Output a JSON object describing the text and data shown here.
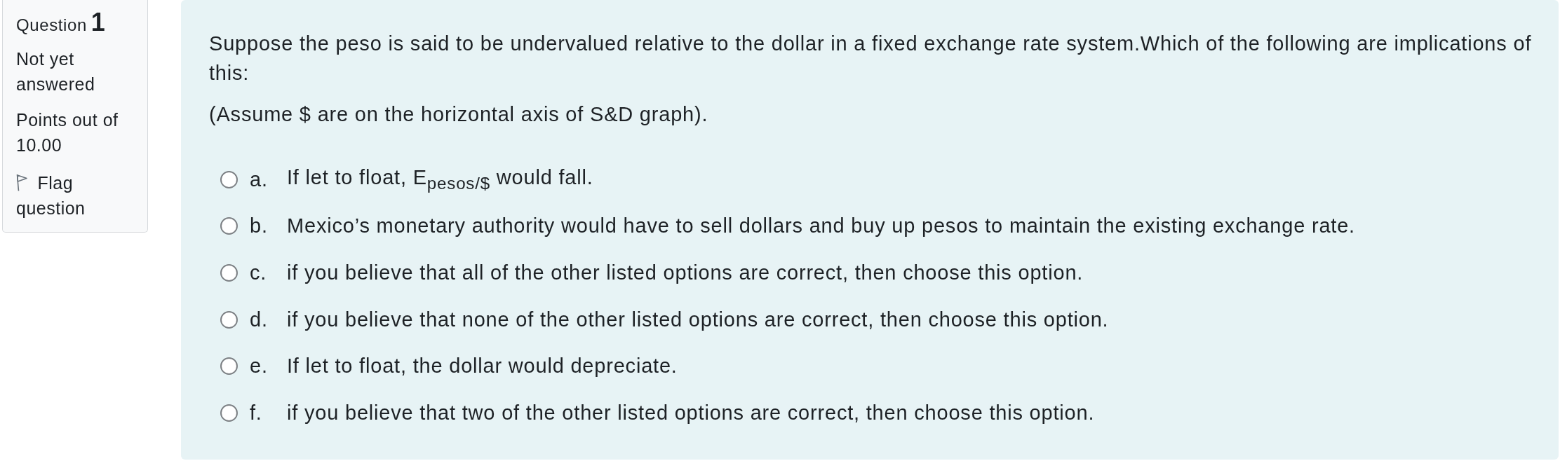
{
  "question_info": {
    "label": "Question",
    "number": "1",
    "status": "Not yet answered",
    "points": "Points out of 10.00",
    "flag": {
      "label": "Flag question",
      "flagged": false
    }
  },
  "question": {
    "text": "Suppose the peso is said to be undervalued relative to the dollar in a fixed exchange rate system.Which of the following are implications of this:",
    "note": "(Assume $ are on the horizontal axis of S&D graph).",
    "options": [
      {
        "letter": "a.",
        "text": "If let to float, E$_{pesos/$}$ would fall.",
        "selected": false
      },
      {
        "letter": "b.",
        "text": "Mexico’s monetary authority would have to sell dollars and buy up pesos to maintain the existing exchange rate.",
        "selected": false
      },
      {
        "letter": "c.",
        "text": "if you believe that all of the other listed options are correct, then choose this option.",
        "selected": false
      },
      {
        "letter": "d.",
        "text": "if you believe that none of the other listed options are correct, then choose this option.",
        "selected": false
      },
      {
        "letter": "e.",
        "text": "If let to float, the dollar would depreciate.",
        "selected": false
      },
      {
        "letter": "f.",
        "text": "if you believe that two of the other listed options are correct, then choose this option.",
        "selected": false
      }
    ]
  }
}
